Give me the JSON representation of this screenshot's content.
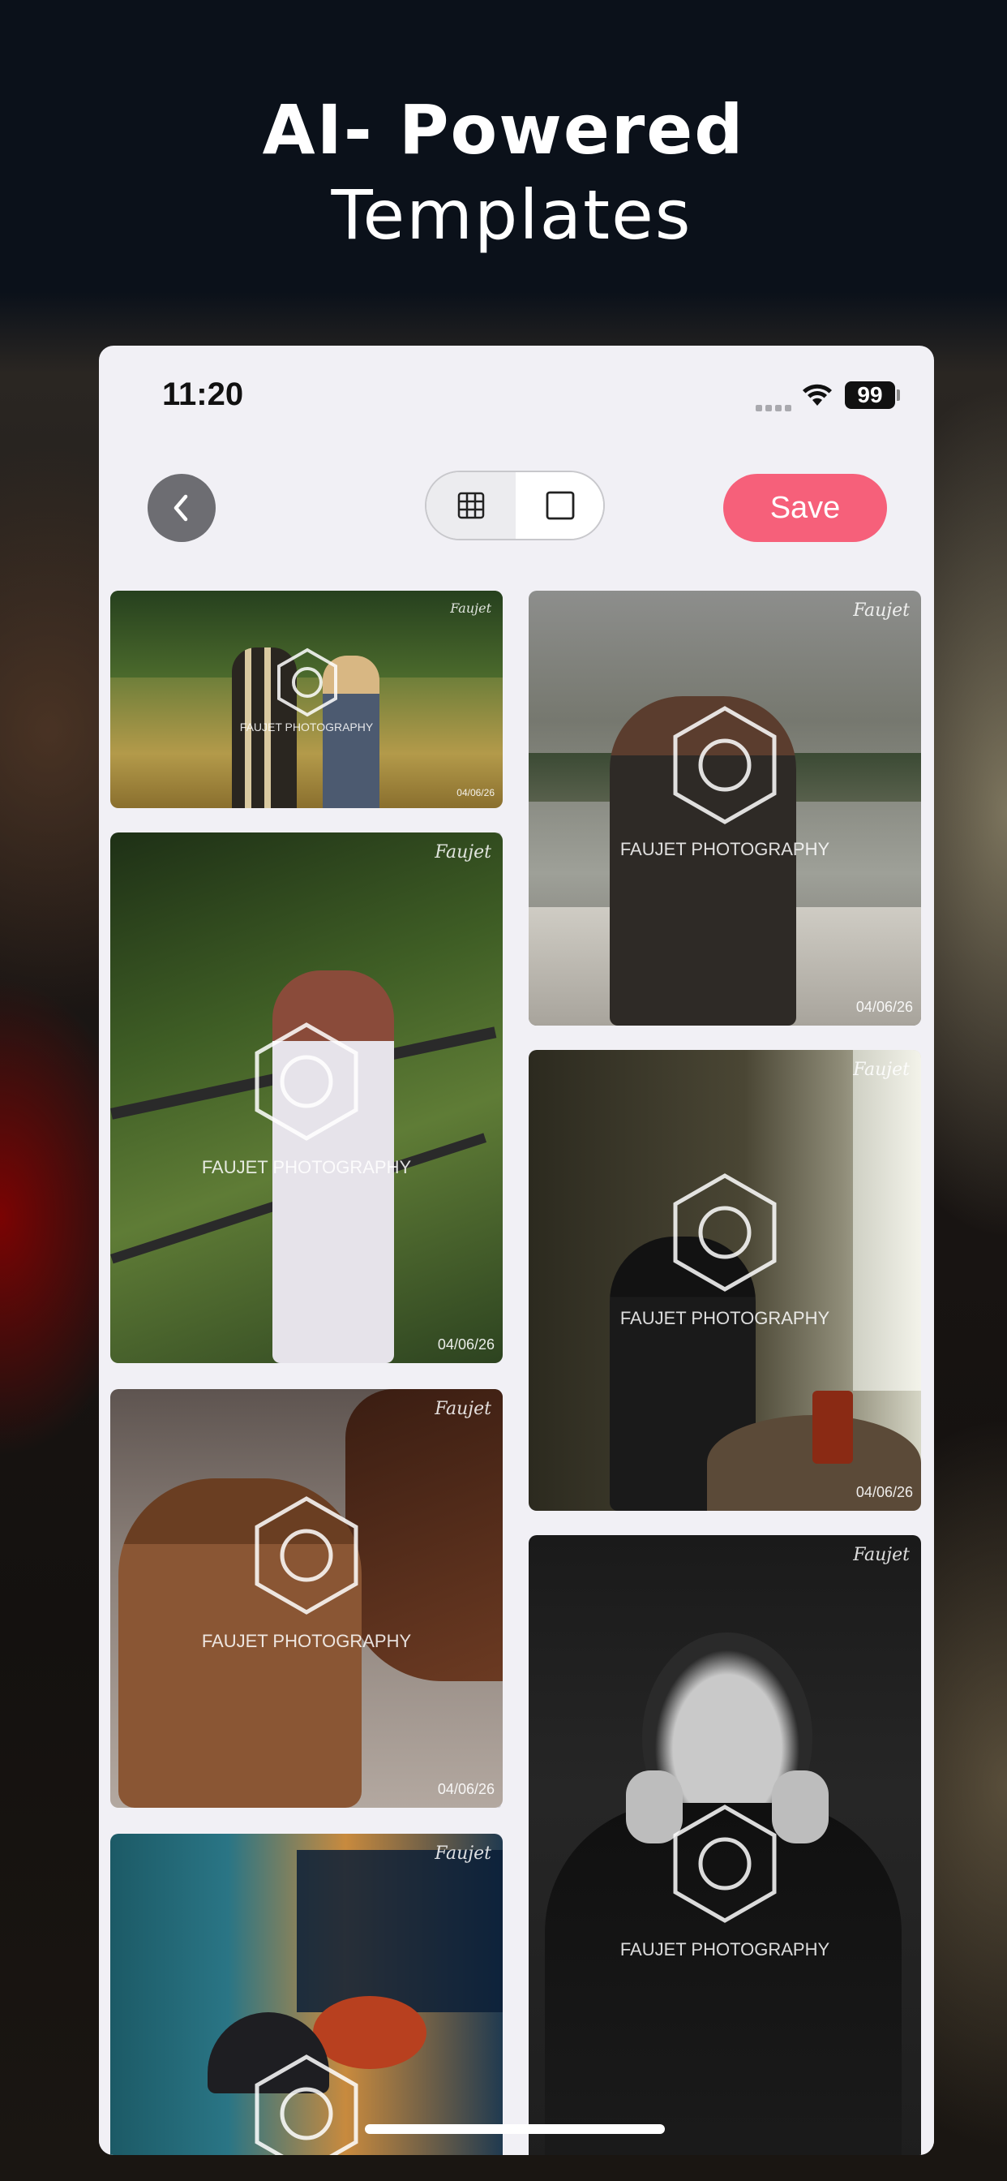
{
  "headline": {
    "line1": "AI- Powered",
    "line2": "Templates"
  },
  "status_bar": {
    "time": "11:20",
    "battery": "99"
  },
  "toolbar": {
    "back_icon": "chevron-left-icon",
    "grid_icon": "grid-icon",
    "single_icon": "square-icon",
    "save_label": "Save"
  },
  "colors": {
    "accent": "#f6607a",
    "back_button": "#6d6d72",
    "panel": "#f1f0f5"
  },
  "photos": [
    {
      "watermark": "FAUJET PHOTOGRAPHY",
      "signature": "Faujet",
      "date": "04/06/26"
    },
    {
      "watermark": "FAUJET PHOTOGRAPHY",
      "signature": "Faujet",
      "date": "04/06/26"
    },
    {
      "watermark": "FAUJET PHOTOGRAPHY",
      "signature": "Faujet",
      "date": "04/06/26"
    },
    {
      "watermark": "FAUJET PHOTOGRAPHY",
      "signature": "Faujet",
      "date": "04/06/26"
    },
    {
      "watermark": "FAUJET PHOTOGRAPHY",
      "signature": "Faujet",
      "date": "04/06/26"
    },
    {
      "watermark": "",
      "signature": "Faujet",
      "date": ""
    },
    {
      "watermark": "FAUJET PHOTOGRAPHY",
      "signature": "Faujet",
      "date": ""
    }
  ]
}
